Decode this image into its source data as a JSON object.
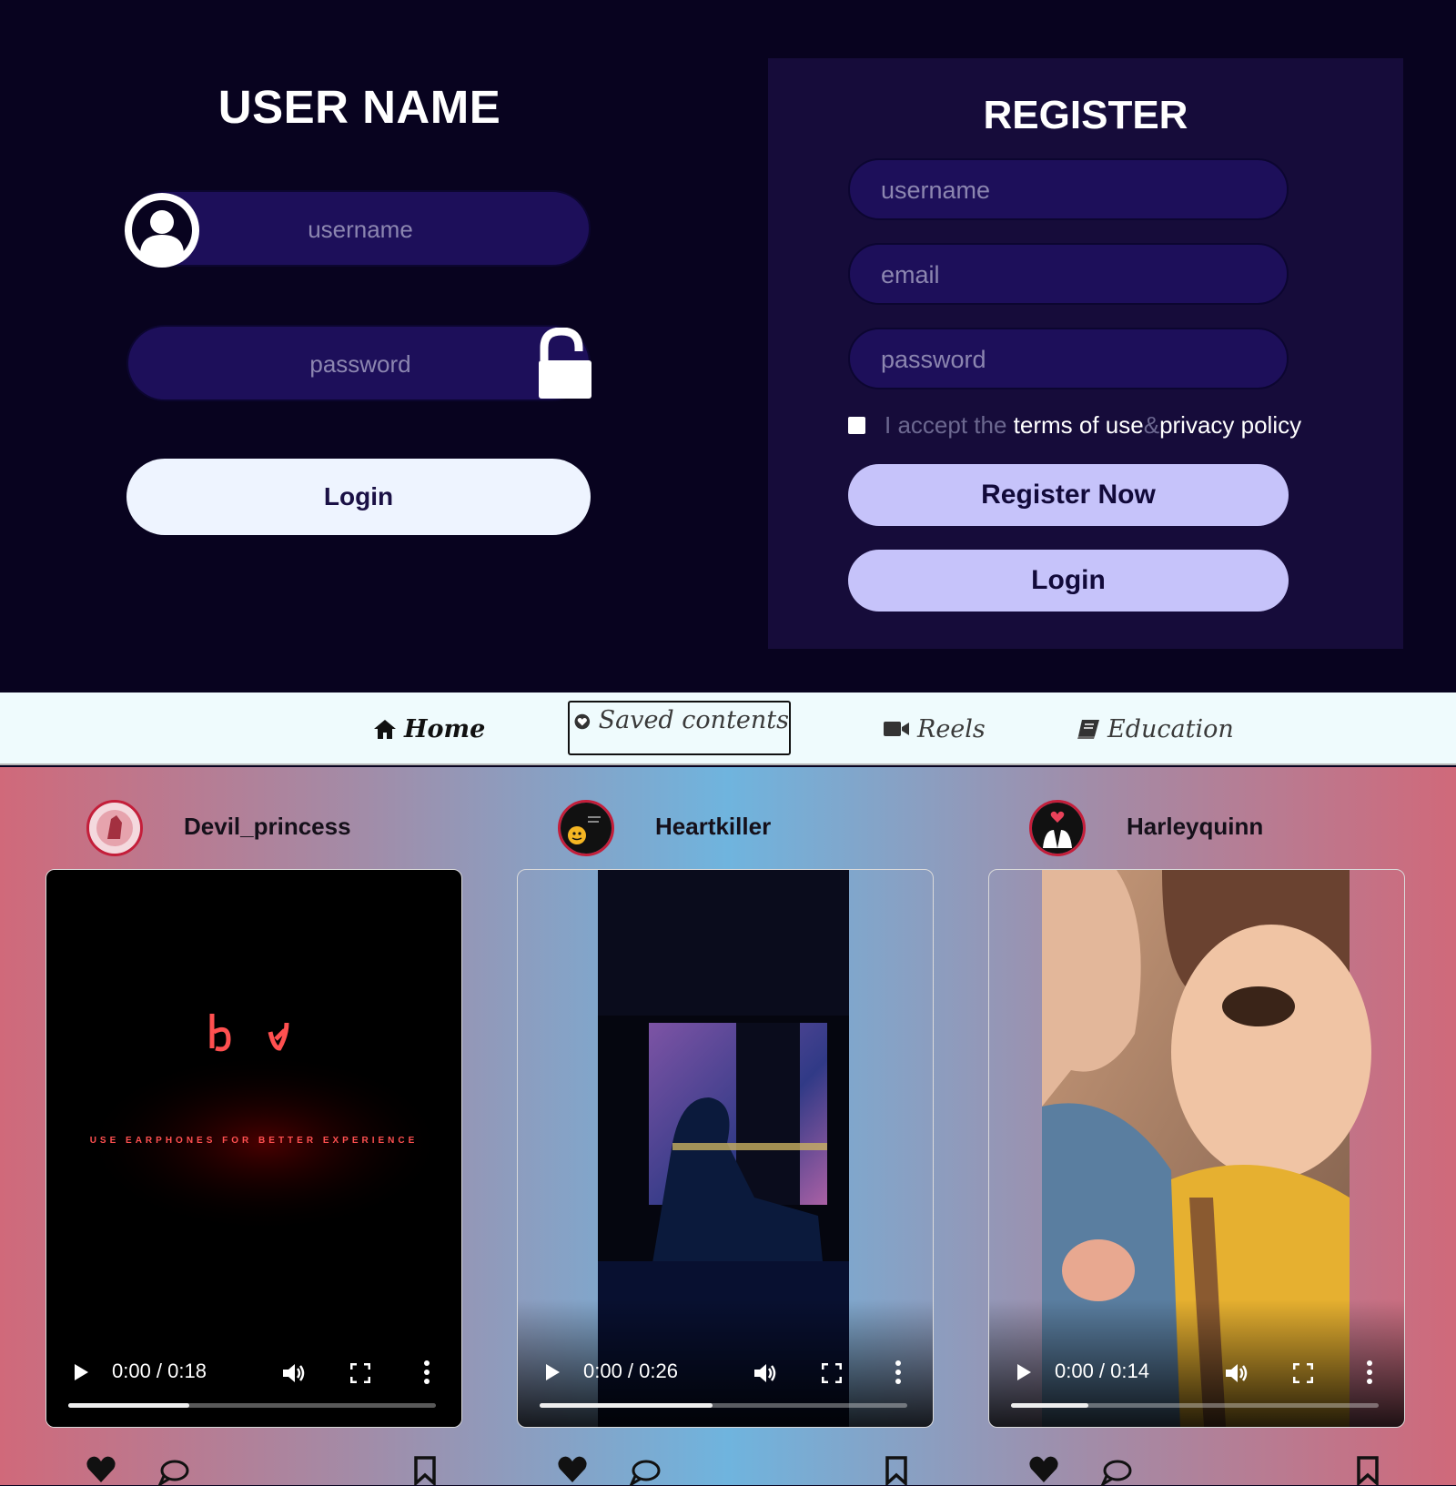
{
  "login": {
    "title": "USER NAME",
    "username_placeholder": "username",
    "password_placeholder": "password",
    "login_label": "Login"
  },
  "register": {
    "title": "REGISTER",
    "username_placeholder": "username",
    "email_placeholder": "email",
    "password_placeholder": "password",
    "terms_prefix": "I accept the ",
    "terms_link1": "terms of use",
    "terms_amp": "&",
    "terms_link2": "privacy policy",
    "register_label": "Register Now",
    "login_label": "Login"
  },
  "nav": {
    "home": "Home",
    "saved": "Saved contents",
    "reels": "Reels",
    "education": "Education"
  },
  "posts": [
    {
      "user": "Devil_princess",
      "time": "0:00 / 0:18",
      "progress": 0.33,
      "overlay_text": "USE EARPHONES FOR BETTER EXPERIENCE"
    },
    {
      "user": "Heartkiller",
      "time": "0:00 / 0:26",
      "progress": 0.47
    },
    {
      "user": "Harleyquinn",
      "time": "0:00 / 0:14",
      "progress": 0.21
    }
  ],
  "colors": {
    "bg_dark": "#08031f",
    "field": "#1d0f5a",
    "panel": "#160c3a",
    "button_light": "#c6c3fa",
    "accent_red": "#c41e3a"
  }
}
